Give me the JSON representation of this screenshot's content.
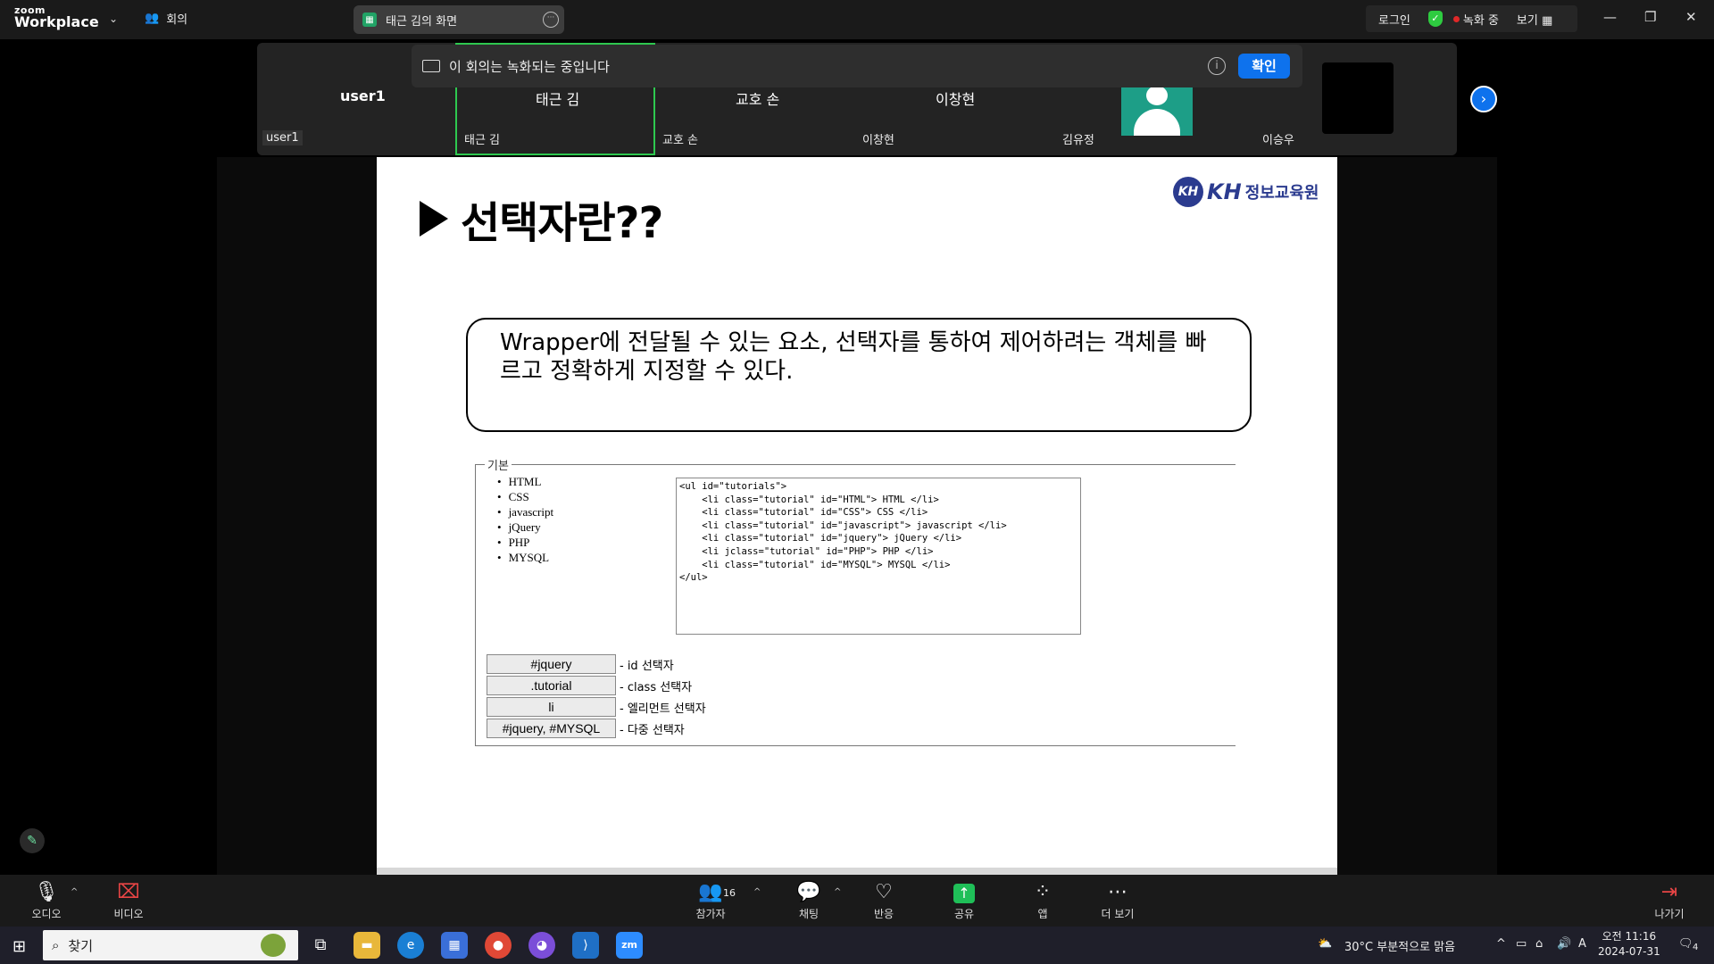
{
  "topbar": {
    "logo_small": "zoom",
    "logo_big": "Workplace",
    "meeting_label": "회의",
    "share_title": "태근 김의 화면",
    "login": "로그인",
    "recording": "녹화 중",
    "view": "보기"
  },
  "participants": [
    {
      "title": "user1",
      "name": "user1"
    },
    {
      "title": "태근 김",
      "name": "태근 김"
    },
    {
      "title": "교호 손",
      "name": "교호 손"
    },
    {
      "title": "이창현",
      "name": "이창현"
    },
    {
      "title": "",
      "name": "김유정"
    },
    {
      "title": "",
      "name": "이승우"
    }
  ],
  "banner": {
    "text": "이 회의는 녹화되는 중입니다",
    "confirm": "확인"
  },
  "slide": {
    "title": "선택자란??",
    "logo_badge": "KH",
    "logo_text": "KH",
    "logo_sub": "정보교육원",
    "description": "Wrapper에 전달될 수 있는 요소, 선택자를 통하여 제어하려는 객체를 빠르고 정확하게 지정할 수 있다.",
    "legend": "기본",
    "list": [
      "HTML",
      "CSS",
      "javascript",
      "jQuery",
      "PHP",
      "MYSQL"
    ],
    "code": "<ul id=\"tutorials\">\n    <li class=\"tutorial\" id=\"HTML\"> HTML </li>\n    <li class=\"tutorial\" id=\"CSS\"> CSS </li>\n    <li class=\"tutorial\" id=\"javascript\"> javascript </li>\n    <li class=\"tutorial\" id=\"jquery\"> jQuery </li>\n    <li jclass=\"tutorial\" id=\"PHP\"> PHP </li>\n    <li class=\"tutorial\" id=\"MYSQL\"> MYSQL </li>\n</ul>",
    "buttons": [
      {
        "label": "#jquery",
        "desc": "- id 선택자"
      },
      {
        "label": ".tutorial",
        "desc": "- class 선택자"
      },
      {
        "label": "li",
        "desc": "- 엘리먼트 선택자"
      },
      {
        "label": "#jquery, #MYSQL",
        "desc": "- 다중 선택자"
      }
    ]
  },
  "toolbar": {
    "audio": "오디오",
    "video": "비디오",
    "participants": "참가자",
    "participants_count": "16",
    "chat": "채팅",
    "react": "반응",
    "share": "공유",
    "apps": "앱",
    "more": "더 보기",
    "leave": "나가기"
  },
  "taskbar": {
    "search": "찾기",
    "weather": "30°C  부분적으로 맑음",
    "ime": "A",
    "time": "오전 11:16",
    "date": "2024-07-31",
    "notifications": "4"
  }
}
